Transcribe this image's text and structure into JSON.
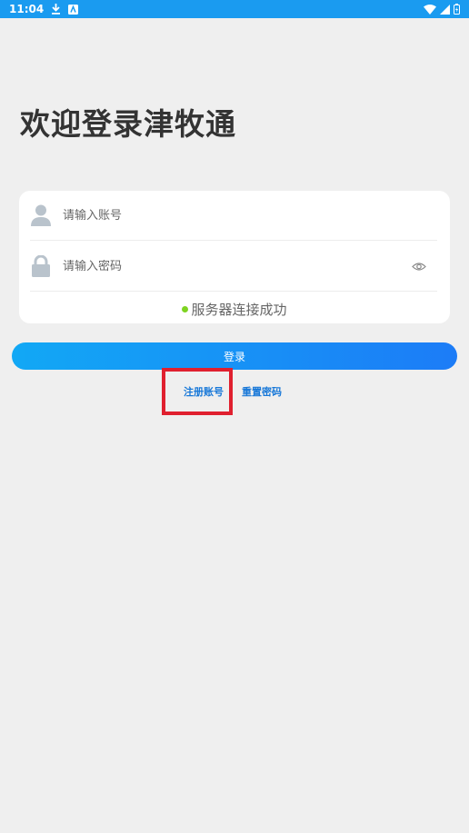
{
  "status_bar": {
    "time": "11:04",
    "icons": [
      "download-icon",
      "notification-icon",
      "wifi-icon",
      "signal-icon",
      "battery-icon"
    ]
  },
  "welcome_title": "欢迎登录津牧通",
  "form": {
    "account_placeholder": "请输入账号",
    "password_placeholder": "请输入密码",
    "server_status": "服务器连接成功"
  },
  "login_label": "登录",
  "links": {
    "register": "注册账号",
    "reset": "重置密码"
  },
  "colors": {
    "status_bar": "#1a9bf0",
    "accent": "#1c7cf7",
    "success": "#7ed321",
    "highlight": "#e0202f"
  }
}
